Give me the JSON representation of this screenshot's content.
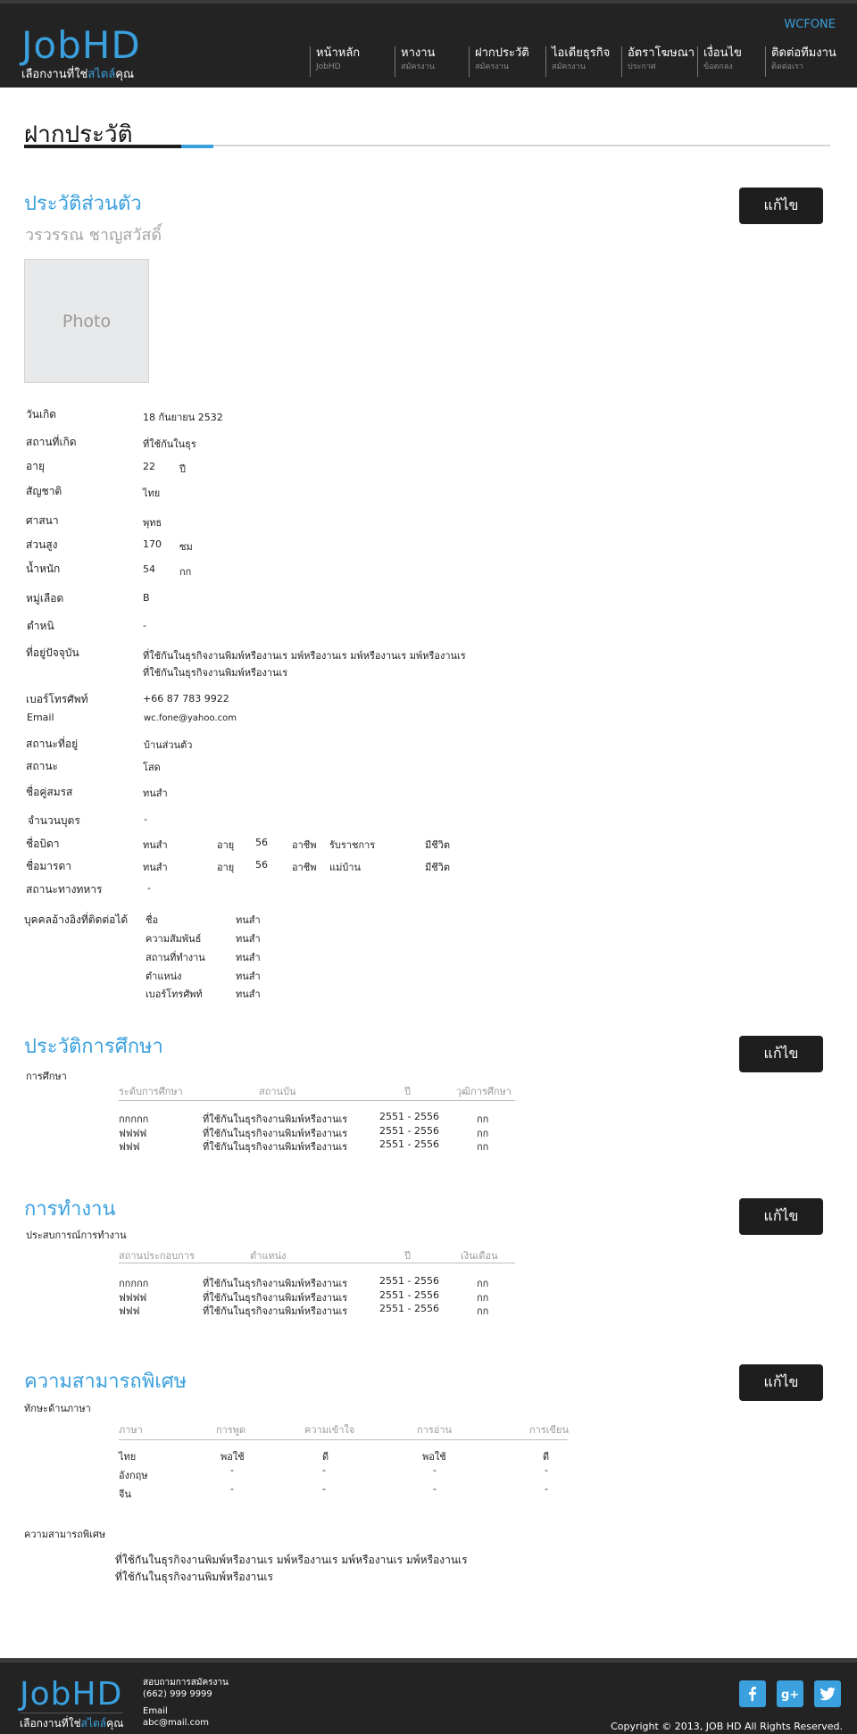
{
  "header": {
    "logo": "JobHD",
    "tagline_prefix": "เลือกงานที่ใช่",
    "tagline_highlight": "สไตล์",
    "tagline_suffix": "คุณ",
    "user": "WCFONE",
    "nav": [
      {
        "label": "หน้าหลัก",
        "sub": "JobHD"
      },
      {
        "label": "หางาน",
        "sub": "สมัครงาน"
      },
      {
        "label": "ฝากประวัติ",
        "sub": "สมัครงาน"
      },
      {
        "label": "ไอเดียธุรกิจ",
        "sub": "สมัครงาน"
      },
      {
        "label": "อัตราโฆษณา",
        "sub": "ประกาศ"
      },
      {
        "label": "เงื่อนไข",
        "sub": "ข้อตกลง"
      },
      {
        "label": "ติดต่อทีมงาน",
        "sub": "ติดต่อเรา"
      }
    ]
  },
  "page_title": "ฝากประวัติ",
  "edit_label": "แก้ไข",
  "personal": {
    "title": "ประวัติส่วนตัว",
    "name": "วรวรรณ ชาญสวัสดิ์",
    "photo": "Photo",
    "rows": [
      {
        "label": "วันเกิด",
        "value": "18  กันยายน  2532"
      },
      {
        "label": "สถานที่เกิด",
        "value": "ที่ใช้กันในธุร"
      },
      {
        "label": "อายุ",
        "value": "22",
        "unit": "ปี"
      },
      {
        "label": "สัญชาติ",
        "value": "ไทย"
      },
      {
        "label": "ศาสนา",
        "value": "พุทธ"
      },
      {
        "label": "ส่วนสูง",
        "value": "170",
        "unit": "ซม"
      },
      {
        "label": "น้ำหนัก",
        "value": "54",
        "unit": "กก"
      },
      {
        "label": "หมู่เลือด",
        "value": "B"
      },
      {
        "label": "ตำหนิ",
        "value": "-"
      },
      {
        "label": "ที่อยู่ปัจจุบัน",
        "value": "ที่ใช้กันในธุรกิจงานพิมพ์หรืองานเร มพ์หรืองานเร มพ์หรืองานเร มพ์หรืองานเร",
        "value2": "ที่ใช้กันในธุรกิจงานพิมพ์หรืองานเร"
      },
      {
        "label": "เบอร์โทรศัพท์",
        "value": "+66  87  783  9922"
      },
      {
        "label": "Email",
        "value": "wc.fone@yahoo.com"
      },
      {
        "label": "สถานะที่อยู่",
        "value": "บ้านส่วนตัว"
      },
      {
        "label": "สถานะ",
        "value": "โสด"
      },
      {
        "label": "ชื่อคู่สมรส",
        "value": "ทนสำ"
      },
      {
        "label": "จำนวนบุตร",
        "value": "-"
      }
    ],
    "parents": [
      {
        "label": "ชื่อบิดา",
        "name": "ทนสำ",
        "age_label": "อายุ",
        "age": "56",
        "job_label": "อาชีพ",
        "job": "รับราชการ",
        "status": "มีชีวิต"
      },
      {
        "label": "ชื่อมารดา",
        "name": "ทนสำ",
        "age_label": "อายุ",
        "age": "56",
        "job_label": "อาชีพ",
        "job": "แม่บ้าน",
        "status": "มีชีวิต"
      }
    ],
    "military_label": "สถานะทางทหาร",
    "military_value": "-",
    "reference_label": "บุคคลอ้างอิงที่ติดต่อได้",
    "reference": [
      {
        "label": "ชื่อ",
        "value": "ทนสำ"
      },
      {
        "label": "ความสัมพันธ์",
        "value": "ทนสำ"
      },
      {
        "label": "สถานที่ทำงาน",
        "value": "ทนสำ"
      },
      {
        "label": "ตำแหน่ง",
        "value": "ทนสำ"
      },
      {
        "label": "เบอร์โทรศัพท์",
        "value": "ทนสำ"
      }
    ]
  },
  "education": {
    "title": "ประวัติการศึกษา",
    "label": "การศึกษา",
    "headers": [
      "ระดับการศึกษา",
      "สถานบัน",
      "ปี",
      "วุฒิการศึกษา"
    ],
    "rows": [
      [
        "กกกกก",
        "ที่ใช้กันในธุรกิจงานพิมพ์หรืองานเร",
        "2551  -  2556",
        "กก"
      ],
      [
        "ฟฟฟฟ",
        "ที่ใช้กันในธุรกิจงานพิมพ์หรืองานเร",
        "2551  -  2556",
        "กก"
      ],
      [
        "ฟฟฟ",
        "ที่ใช้กันในธุรกิจงานพิมพ์หรืองานเร",
        "2551  -  2556",
        "กก"
      ]
    ]
  },
  "work": {
    "title": "การทำงาน",
    "label": "ประสบการณ์การทำงาน",
    "headers": [
      "สถานประกอบการ",
      "ตำแหน่ง",
      "ปี",
      "เงินเดือน"
    ],
    "rows": [
      [
        "กกกกก",
        "ที่ใช้กันในธุรกิจงานพิมพ์หรืองานเร",
        "2551  -  2556",
        "กก"
      ],
      [
        "ฟฟฟฟ",
        "ที่ใช้กันในธุรกิจงานพิมพ์หรืองานเร",
        "2551  -  2556",
        "กก"
      ],
      [
        "ฟฟฟ",
        "ที่ใช้กันในธุรกิจงานพิมพ์หรืองานเร",
        "2551  -  2556",
        "กก"
      ]
    ]
  },
  "skills": {
    "title": "ความสามารถพิเศษ",
    "label": "ทักษะด้านภาษา",
    "headers": [
      "ภาษา",
      "การพูด",
      "ความเข้าใจ",
      "การอ่าน",
      "การเขียน"
    ],
    "rows": [
      [
        "ไทย",
        "พอใช้",
        "ดี",
        "พอใช้",
        "ดี"
      ],
      [
        "อังกฤษ",
        "-",
        "-",
        "-",
        "-"
      ],
      [
        "จีน",
        "-",
        "-",
        "-",
        "-"
      ]
    ],
    "special_label": "ความสามารถพิเศษ",
    "special_text": "ที่ใช้กันในธุรกิจงานพิมพ์หรืองานเร มพ์หรืองานเร มพ์หรืองานเร มพ์หรืองานเร",
    "special_text2": "ที่ใช้กันในธุรกิจงานพิมพ์หรืองานเร"
  },
  "footer": {
    "logo": "JobHD",
    "tagline_prefix": "เลือกงานที่ใช่",
    "tagline_highlight": "สไตล์",
    "tagline_suffix": "คุณ",
    "contact_title": "สอบถามการสมัครงาน",
    "phone": "(662) 999 9999",
    "email_label": "Email",
    "email": "abc@mail.com",
    "copyright": "Copyright © 2013, JOB HD All Rights Reserved.",
    "social": [
      "facebook-icon",
      "google-plus-icon",
      "twitter-icon"
    ]
  },
  "colors": {
    "accent": "#3aa0de",
    "dark": "#232323",
    "button": "#1e1e1e"
  }
}
